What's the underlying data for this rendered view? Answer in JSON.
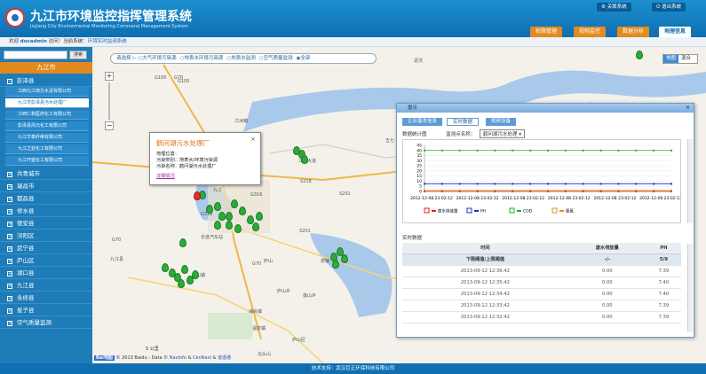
{
  "app": {
    "title": "九江市环境监控指挥管理系统",
    "subtitle": "Jiujiang City Environmental Monitoring Command Management System",
    "top_links": [
      {
        "label": "关联系统"
      },
      {
        "label": "退出系统"
      }
    ],
    "nav_tabs": [
      {
        "label": "权限管理"
      },
      {
        "label": "视频监控"
      },
      {
        "label": "数据分析"
      },
      {
        "label": "地理信息"
      }
    ]
  },
  "breadcrumb": {
    "welcome": "欢迎",
    "user": "docadmin",
    "visit": "访问！当前系统：",
    "current": "环境实时监测系统"
  },
  "sidebar": {
    "search_placeholder": "",
    "search_button": "搜索",
    "city": "九江市",
    "groups": [
      {
        "label": "彭泽县",
        "icon": "minus"
      },
      {
        "label": "共青城市",
        "icon": "plus"
      },
      {
        "label": "瑞昌市",
        "icon": "plus"
      },
      {
        "label": "都昌县",
        "icon": "plus"
      },
      {
        "label": "修水县",
        "icon": "plus"
      },
      {
        "label": "德安县",
        "icon": "plus"
      },
      {
        "label": "浔阳区",
        "icon": "plus"
      },
      {
        "label": "武宁县",
        "icon": "plus"
      },
      {
        "label": "庐山区",
        "icon": "plus"
      },
      {
        "label": "湖口县",
        "icon": "plus"
      },
      {
        "label": "九江县",
        "icon": "plus"
      },
      {
        "label": "永修县",
        "icon": "plus"
      },
      {
        "label": "星子县",
        "icon": "plus"
      },
      {
        "label": "空气质量监测",
        "icon": "plus"
      }
    ],
    "companies": [
      {
        "label": "江西九江南方水泥有限公司"
      },
      {
        "label": "九江市彭泽县污水处理厂"
      },
      {
        "label": "江西仁和医药化工有限公司"
      },
      {
        "label": "彭泽县风元化工有限公司"
      },
      {
        "label": "九江华泰纤维有限公司"
      },
      {
        "label": "九江之亚化工有限公司"
      },
      {
        "label": "九江开盛化工有限公司"
      }
    ]
  },
  "map": {
    "filter_prefix": "请选择",
    "filters": [
      {
        "label": "大气环境污染源"
      },
      {
        "label": "地表水环境污染源"
      },
      {
        "label": "地表水监测"
      },
      {
        "label": "空气质量监测"
      },
      {
        "label": "全部"
      }
    ],
    "map_types": [
      {
        "label": "地图"
      },
      {
        "label": "混合"
      }
    ],
    "place_labels": [
      "G105",
      "G70",
      "G105",
      "江洲镇",
      "新港镇",
      "九江",
      "G316",
      "江北大道",
      "五七",
      "G316",
      "S201",
      "庐山",
      "G316",
      "庐山乡",
      "海会镇",
      "温泉镇",
      "S201",
      "G70",
      "马头山",
      "莲山乡",
      "泉镇",
      "G70",
      "九江县",
      "公山镇",
      "庐山区",
      "江新洲",
      "泥汊",
      "S218",
      "长途汽车站"
    ],
    "scale_label": "5 公里",
    "copyright": {
      "brand": "Bai地图",
      "text": "© 2013 Baidu - Data ©",
      "link1": "NavInfo",
      "amp": "&",
      "link2": "CenNavi",
      "link3": "道道通"
    }
  },
  "popup": {
    "title": "鹤问湖污水处理厂",
    "lines": [
      "地理位置：",
      "污染类别：地表水/环境污染源",
      "污染名称：鹤问湖污水处理厂"
    ],
    "link": "详细情况",
    "close": "×"
  },
  "panel": {
    "title": "提示",
    "close": "×",
    "tabs": [
      {
        "label": "企业基本信息"
      },
      {
        "label": "实时数据"
      },
      {
        "label": "视频设备"
      }
    ],
    "chart_label": "数据统计图",
    "monitor_label": "监测点名称：",
    "monitor_value": "鹤问湖污水处理",
    "realtime_label": "实时数据",
    "table_headers": [
      "时间",
      "废水排放量",
      "PH"
    ],
    "limit_row": [
      "下限阈值/上限阈值",
      "-/-",
      "5/9"
    ],
    "rows": [
      [
        "2013-09-12 12:36:42",
        "0.00",
        "7.39"
      ],
      [
        "2013-09-12 12:35:42",
        "0.00",
        "7.40"
      ],
      [
        "2013-09-12 12:34:42",
        "0.00",
        "7.40"
      ],
      [
        "2013-09-12 12:33:42",
        "0.00",
        "7.39"
      ],
      [
        "2013-09-12 12:32:42",
        "0.00",
        "7.39"
      ]
    ]
  },
  "chart_data": {
    "type": "line",
    "x": [
      "2012-12-08 23:02:12",
      "2012-12-08 23:02:12",
      "2012-12-08 23:02:12",
      "2012-12-08 23:02:12",
      "2012-12-08 23:02:12",
      "2012-12-08 23:02:12",
      "2012-12-08 23:02:12",
      "2012-12-08 23:02:12",
      "2012-12-08 23:02:12",
      "2012-12-08 23:02:12",
      "2012-12-08 23:02:12",
      "2012-12-08 23:02:12",
      "2012-12-08 23:02:12",
      "2012-12-08 23:02:12",
      "2012-12-08 23:02:12"
    ],
    "x_tick_labels": [
      "2012-12-08 23:02:12",
      "2012-12-08 23:02:12",
      "2012-12-08 23:02:12",
      "2012-12-08 23:02:12",
      "2012-12-08 23:02:12",
      "2012-12-08 23:02:12"
    ],
    "yticks": [
      45,
      40,
      35,
      30,
      25,
      20,
      15,
      10,
      5,
      0
    ],
    "ylim": [
      0,
      45
    ],
    "series": [
      {
        "name": "废水排放量",
        "color": "#e02020",
        "values": [
          0,
          0,
          0,
          0,
          0,
          0,
          0,
          0,
          0,
          0,
          0,
          0,
          0,
          0,
          0
        ]
      },
      {
        "name": "PH",
        "color": "#2030d0",
        "values": [
          7.4,
          7.4,
          7.4,
          7.4,
          7.4,
          7.4,
          7.4,
          7.4,
          7.4,
          7.4,
          7.4,
          7.4,
          7.4,
          7.4,
          7.4
        ]
      },
      {
        "name": "COD",
        "color": "#20b020",
        "values": [
          40,
          40,
          40,
          40,
          40,
          40,
          40,
          40,
          40,
          40,
          40,
          40,
          40,
          40,
          40
        ]
      },
      {
        "name": "氨氮",
        "color": "#e09020",
        "values": [
          1,
          1,
          1,
          1,
          1,
          1,
          1,
          1,
          1,
          1,
          1,
          1,
          1,
          1,
          1
        ]
      }
    ]
  },
  "footer": {
    "text": "技术支持：武汉巨正环保科技有限公司"
  },
  "colors": {
    "header": "#1380c4",
    "accent": "#e48a1f",
    "sidebar": "#1e7cb8"
  }
}
